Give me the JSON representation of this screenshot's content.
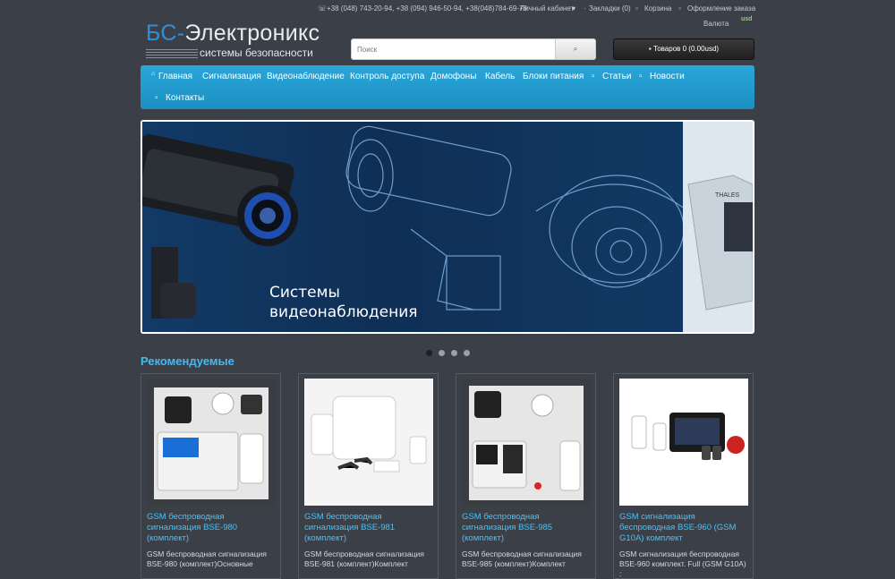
{
  "topbar": {
    "phones": "+38 (048) 743-20-94, +38 (094) 946-50-94, +38(048)784-69-78",
    "account": "Личный кабинет",
    "bookmarks": "Закладки (0)",
    "cart": "Корзина",
    "checkout": "Оформление заказа",
    "currency": "Валюта",
    "currency_code": "usd"
  },
  "logo": {
    "brand_first": "БС-",
    "brand_rest": "Электроникс",
    "tagline": "системы безопасности"
  },
  "search": {
    "placeholder": "Поиск"
  },
  "cart_button": "Товаров 0 (0.00usd)",
  "nav": {
    "items": [
      "Главная",
      "Сигнализация",
      "Видеонаблюдение",
      "Контроль доступа",
      "Домофоны",
      "Кабель",
      "Блоки питания",
      "Статьи",
      "Новости",
      "Контакты"
    ]
  },
  "slider": {
    "caption_line1": "Системы",
    "caption_line2": "видеонаблюдения",
    "panel_brand": "THALES"
  },
  "recommended": {
    "title": "Рекомендуемые",
    "products": [
      {
        "name": "GSM беспроводная сигнализация BSE-980 (комплект)",
        "desc": "GSM беспроводная сигнализация BSE-980 (комплект)Основные"
      },
      {
        "name": "GSM беспроводная сигнализация BSE-981 (комплект)",
        "desc": "GSM беспроводная сигнализация BSE-981 (комплект)Комплект"
      },
      {
        "name": "GSM беспроводная сигнализация BSE-985 (комплект)",
        "desc": "GSM беспроводная сигнализация BSE-985 (комплект)Комплект"
      },
      {
        "name": "GSM сигнализация беспроводная BSE-960 (GSM G10A) комплект",
        "desc": "GSM сигнализация беспроводная BSE-960 комплект. Full (GSM G10A) :"
      }
    ]
  },
  "colors": {
    "background": "#3b4048",
    "nav": "#2aa6d9",
    "link": "#4cc0f5",
    "accent": "#47b8ef"
  },
  "icons": [
    "phone-icon",
    "user-icon",
    "heart-icon",
    "cart-icon",
    "share-icon",
    "search-icon",
    "home-icon",
    "info-icon"
  ]
}
